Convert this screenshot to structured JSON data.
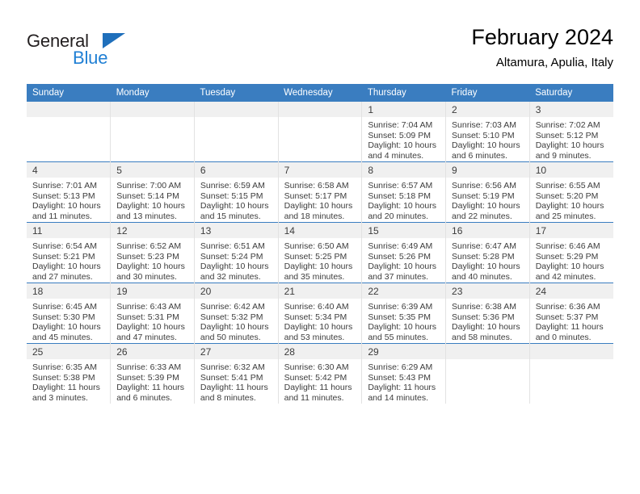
{
  "brand": {
    "name_top": "General",
    "name_bottom": "Blue",
    "color_dark": "#231f20",
    "color_blue": "#1f7fd4"
  },
  "header": {
    "title": "February 2024",
    "subtitle": "Altamura, Apulia, Italy"
  },
  "theme": {
    "header_bg": "#3a7dc0",
    "header_text": "#ffffff",
    "daynum_band_bg": "#f0f0f0",
    "row_divider": "#3a7dc0",
    "col_divider": "#e2e2e2",
    "text": "#3c3c3c"
  },
  "weekdays": [
    "Sunday",
    "Monday",
    "Tuesday",
    "Wednesday",
    "Thursday",
    "Friday",
    "Saturday"
  ],
  "weeks": [
    [
      {
        "empty": true
      },
      {
        "empty": true
      },
      {
        "empty": true
      },
      {
        "empty": true
      },
      {
        "day": "1",
        "sunrise": "Sunrise: 7:04 AM",
        "sunset": "Sunset: 5:09 PM",
        "daylight1": "Daylight: 10 hours",
        "daylight2": "and 4 minutes."
      },
      {
        "day": "2",
        "sunrise": "Sunrise: 7:03 AM",
        "sunset": "Sunset: 5:10 PM",
        "daylight1": "Daylight: 10 hours",
        "daylight2": "and 6 minutes."
      },
      {
        "day": "3",
        "sunrise": "Sunrise: 7:02 AM",
        "sunset": "Sunset: 5:12 PM",
        "daylight1": "Daylight: 10 hours",
        "daylight2": "and 9 minutes."
      }
    ],
    [
      {
        "day": "4",
        "sunrise": "Sunrise: 7:01 AM",
        "sunset": "Sunset: 5:13 PM",
        "daylight1": "Daylight: 10 hours",
        "daylight2": "and 11 minutes."
      },
      {
        "day": "5",
        "sunrise": "Sunrise: 7:00 AM",
        "sunset": "Sunset: 5:14 PM",
        "daylight1": "Daylight: 10 hours",
        "daylight2": "and 13 minutes."
      },
      {
        "day": "6",
        "sunrise": "Sunrise: 6:59 AM",
        "sunset": "Sunset: 5:15 PM",
        "daylight1": "Daylight: 10 hours",
        "daylight2": "and 15 minutes."
      },
      {
        "day": "7",
        "sunrise": "Sunrise: 6:58 AM",
        "sunset": "Sunset: 5:17 PM",
        "daylight1": "Daylight: 10 hours",
        "daylight2": "and 18 minutes."
      },
      {
        "day": "8",
        "sunrise": "Sunrise: 6:57 AM",
        "sunset": "Sunset: 5:18 PM",
        "daylight1": "Daylight: 10 hours",
        "daylight2": "and 20 minutes."
      },
      {
        "day": "9",
        "sunrise": "Sunrise: 6:56 AM",
        "sunset": "Sunset: 5:19 PM",
        "daylight1": "Daylight: 10 hours",
        "daylight2": "and 22 minutes."
      },
      {
        "day": "10",
        "sunrise": "Sunrise: 6:55 AM",
        "sunset": "Sunset: 5:20 PM",
        "daylight1": "Daylight: 10 hours",
        "daylight2": "and 25 minutes."
      }
    ],
    [
      {
        "day": "11",
        "sunrise": "Sunrise: 6:54 AM",
        "sunset": "Sunset: 5:21 PM",
        "daylight1": "Daylight: 10 hours",
        "daylight2": "and 27 minutes."
      },
      {
        "day": "12",
        "sunrise": "Sunrise: 6:52 AM",
        "sunset": "Sunset: 5:23 PM",
        "daylight1": "Daylight: 10 hours",
        "daylight2": "and 30 minutes."
      },
      {
        "day": "13",
        "sunrise": "Sunrise: 6:51 AM",
        "sunset": "Sunset: 5:24 PM",
        "daylight1": "Daylight: 10 hours",
        "daylight2": "and 32 minutes."
      },
      {
        "day": "14",
        "sunrise": "Sunrise: 6:50 AM",
        "sunset": "Sunset: 5:25 PM",
        "daylight1": "Daylight: 10 hours",
        "daylight2": "and 35 minutes."
      },
      {
        "day": "15",
        "sunrise": "Sunrise: 6:49 AM",
        "sunset": "Sunset: 5:26 PM",
        "daylight1": "Daylight: 10 hours",
        "daylight2": "and 37 minutes."
      },
      {
        "day": "16",
        "sunrise": "Sunrise: 6:47 AM",
        "sunset": "Sunset: 5:28 PM",
        "daylight1": "Daylight: 10 hours",
        "daylight2": "and 40 minutes."
      },
      {
        "day": "17",
        "sunrise": "Sunrise: 6:46 AM",
        "sunset": "Sunset: 5:29 PM",
        "daylight1": "Daylight: 10 hours",
        "daylight2": "and 42 minutes."
      }
    ],
    [
      {
        "day": "18",
        "sunrise": "Sunrise: 6:45 AM",
        "sunset": "Sunset: 5:30 PM",
        "daylight1": "Daylight: 10 hours",
        "daylight2": "and 45 minutes."
      },
      {
        "day": "19",
        "sunrise": "Sunrise: 6:43 AM",
        "sunset": "Sunset: 5:31 PM",
        "daylight1": "Daylight: 10 hours",
        "daylight2": "and 47 minutes."
      },
      {
        "day": "20",
        "sunrise": "Sunrise: 6:42 AM",
        "sunset": "Sunset: 5:32 PM",
        "daylight1": "Daylight: 10 hours",
        "daylight2": "and 50 minutes."
      },
      {
        "day": "21",
        "sunrise": "Sunrise: 6:40 AM",
        "sunset": "Sunset: 5:34 PM",
        "daylight1": "Daylight: 10 hours",
        "daylight2": "and 53 minutes."
      },
      {
        "day": "22",
        "sunrise": "Sunrise: 6:39 AM",
        "sunset": "Sunset: 5:35 PM",
        "daylight1": "Daylight: 10 hours",
        "daylight2": "and 55 minutes."
      },
      {
        "day": "23",
        "sunrise": "Sunrise: 6:38 AM",
        "sunset": "Sunset: 5:36 PM",
        "daylight1": "Daylight: 10 hours",
        "daylight2": "and 58 minutes."
      },
      {
        "day": "24",
        "sunrise": "Sunrise: 6:36 AM",
        "sunset": "Sunset: 5:37 PM",
        "daylight1": "Daylight: 11 hours",
        "daylight2": "and 0 minutes."
      }
    ],
    [
      {
        "day": "25",
        "sunrise": "Sunrise: 6:35 AM",
        "sunset": "Sunset: 5:38 PM",
        "daylight1": "Daylight: 11 hours",
        "daylight2": "and 3 minutes."
      },
      {
        "day": "26",
        "sunrise": "Sunrise: 6:33 AM",
        "sunset": "Sunset: 5:39 PM",
        "daylight1": "Daylight: 11 hours",
        "daylight2": "and 6 minutes."
      },
      {
        "day": "27",
        "sunrise": "Sunrise: 6:32 AM",
        "sunset": "Sunset: 5:41 PM",
        "daylight1": "Daylight: 11 hours",
        "daylight2": "and 8 minutes."
      },
      {
        "day": "28",
        "sunrise": "Sunrise: 6:30 AM",
        "sunset": "Sunset: 5:42 PM",
        "daylight1": "Daylight: 11 hours",
        "daylight2": "and 11 minutes."
      },
      {
        "day": "29",
        "sunrise": "Sunrise: 6:29 AM",
        "sunset": "Sunset: 5:43 PM",
        "daylight1": "Daylight: 11 hours",
        "daylight2": "and 14 minutes."
      },
      {
        "empty": true
      },
      {
        "empty": true
      }
    ]
  ]
}
